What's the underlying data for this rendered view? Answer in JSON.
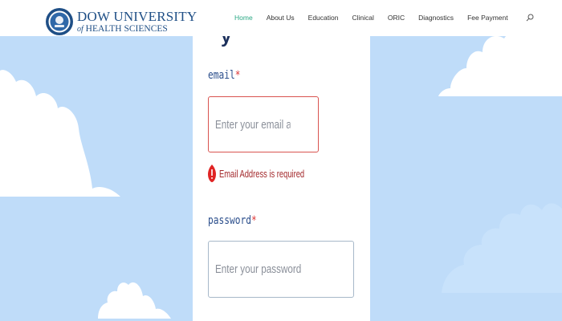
{
  "header": {
    "logo": {
      "line1": "DOW UNIVERSITY",
      "line2_prefix": "of",
      "line2_main": "HEALTH SCIENCES"
    },
    "nav": [
      {
        "label": "Home",
        "active": true
      },
      {
        "label": "About Us",
        "active": false
      },
      {
        "label": "Education",
        "active": false
      },
      {
        "label": "Clinical",
        "active": false
      },
      {
        "label": "ORIC",
        "active": false
      },
      {
        "label": "Diagnostics",
        "active": false
      },
      {
        "label": "Fee Payment",
        "active": false
      }
    ],
    "search_icon": "search-icon"
  },
  "form": {
    "heading_fragment": "y",
    "email": {
      "label": "email",
      "required_mark": "*",
      "placeholder": "Enter your email address",
      "value": "",
      "error": "Email Address is required"
    },
    "password": {
      "label": "password",
      "required_mark": "*",
      "placeholder": "Enter your password",
      "value": ""
    }
  },
  "colors": {
    "background_sky": "#bfdcf9",
    "accent_active_nav": "#2aa884",
    "error": "#d9534f",
    "label": "#2c4f8c",
    "brand": "#1f4f86"
  }
}
